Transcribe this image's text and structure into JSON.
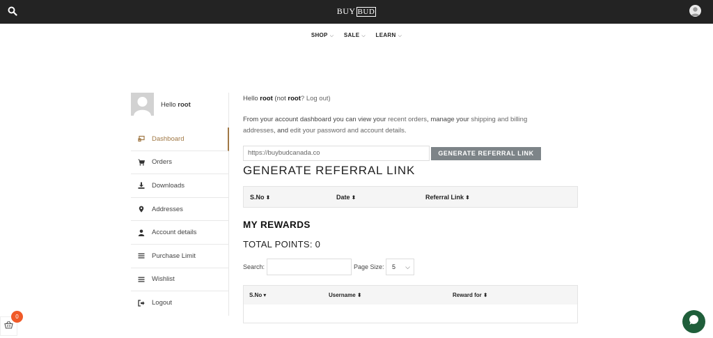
{
  "topbar": {
    "logo_part1": "BUY",
    "logo_part2": "BUD"
  },
  "nav": {
    "items": [
      {
        "label": "SHOP"
      },
      {
        "label": "SALE"
      },
      {
        "label": "LEARN"
      }
    ]
  },
  "user": {
    "greeting": "Hello",
    "name": "root"
  },
  "sidebar": {
    "items": [
      {
        "label": "Dashboard",
        "icon": "dashboard-icon"
      },
      {
        "label": "Orders",
        "icon": "cart-icon"
      },
      {
        "label": "Downloads",
        "icon": "download-icon"
      },
      {
        "label": "Addresses",
        "icon": "map-pin-icon"
      },
      {
        "label": "Account details",
        "icon": "user-icon"
      },
      {
        "label": "Purchase Limit",
        "icon": "list-icon"
      },
      {
        "label": "Wishlist",
        "icon": "list-icon"
      },
      {
        "label": "Logout",
        "icon": "logout-icon"
      }
    ]
  },
  "content": {
    "hello_prefix": "Hello",
    "hello_name": "root",
    "not_prefix": " (not ",
    "not_name": "root",
    "logout_link": "? Log out)",
    "intro_1": "From your account dashboard you can view your ",
    "intro_link_orders": "recent orders",
    "intro_2": ", manage your ",
    "intro_link_addresses": "shipping and billing addresses",
    "intro_3": ", and ",
    "intro_link_account": "edit your password and account details",
    "intro_4": ".",
    "referral_input_value": "https://buybudcanada.co",
    "referral_button": "GENERATE REFERRAL LINK",
    "referral_heading": "GENERATE REFERRAL LINK",
    "referral_table_headers": [
      "S.No",
      "Date",
      "Referral Link"
    ],
    "rewards_heading": "MY REWARDS",
    "total_points_label": "TOTAL POINTS: 0",
    "search_label": "Search:",
    "page_size_label": "Page Size:",
    "page_size_value": "5",
    "rewards_table_headers": [
      "S.No",
      "Username",
      "Reward for"
    ]
  },
  "cart": {
    "count": "0"
  }
}
